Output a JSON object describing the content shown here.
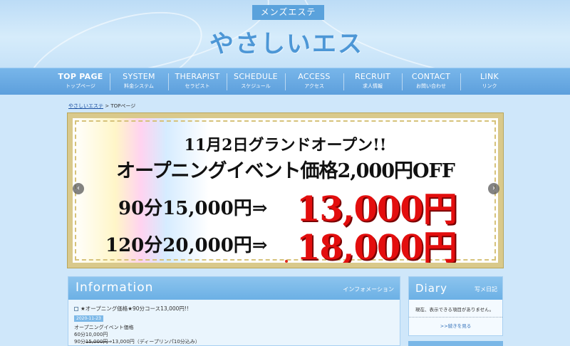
{
  "header": {
    "tagline": "メンズエステ",
    "logo": "やさしいエステ"
  },
  "nav": [
    {
      "en": "TOP PAGE",
      "ja": "トップページ"
    },
    {
      "en": "SYSTEM",
      "ja": "料金システム"
    },
    {
      "en": "THERAPIST",
      "ja": "セラピスト"
    },
    {
      "en": "SCHEDULE",
      "ja": "スケジュール"
    },
    {
      "en": "ACCESS",
      "ja": "アクセス"
    },
    {
      "en": "RECRUIT",
      "ja": "求人情報"
    },
    {
      "en": "CONTACT",
      "ja": "お問い合わせ"
    },
    {
      "en": "LINK",
      "ja": "リンク"
    }
  ],
  "breadcrumb": {
    "home": "やさしいエステ",
    "separator": " > ",
    "current": "TOPページ"
  },
  "slider": {
    "line1": "11月2日グランドオープン!!",
    "line2": "オープニングイベント価格2,000円OFF",
    "line3": "90分15,000円⇒",
    "price1": "13,000円",
    "line4": "120分20,000円⇒",
    "price2": "18,000円",
    "prev_icon": "‹",
    "next_icon": "›"
  },
  "information": {
    "title": "Information",
    "subtitle": "インフォメーション",
    "post_title": "★オープニング価格★90分コース13,000円!!",
    "date": "2020-11-23",
    "body_line1": "オープニングイベント価格",
    "body_line2": "60分10,000円",
    "body_line3_prefix": "90分",
    "body_line3_strike": "15,000円",
    "body_line3_suffix": "⇒13,000円（ディープリンパ10分込み）"
  },
  "diary": {
    "title": "Diary",
    "subtitle": "写メ日記",
    "message": "現在、表示できる項目がありません。",
    "more": ">>続きを見る"
  },
  "colors": {
    "accent": "#6cb0e5",
    "nav_bg": "#5d9fdc",
    "price_red": "#e30e0e",
    "frame_gold": "#d9c98b"
  }
}
